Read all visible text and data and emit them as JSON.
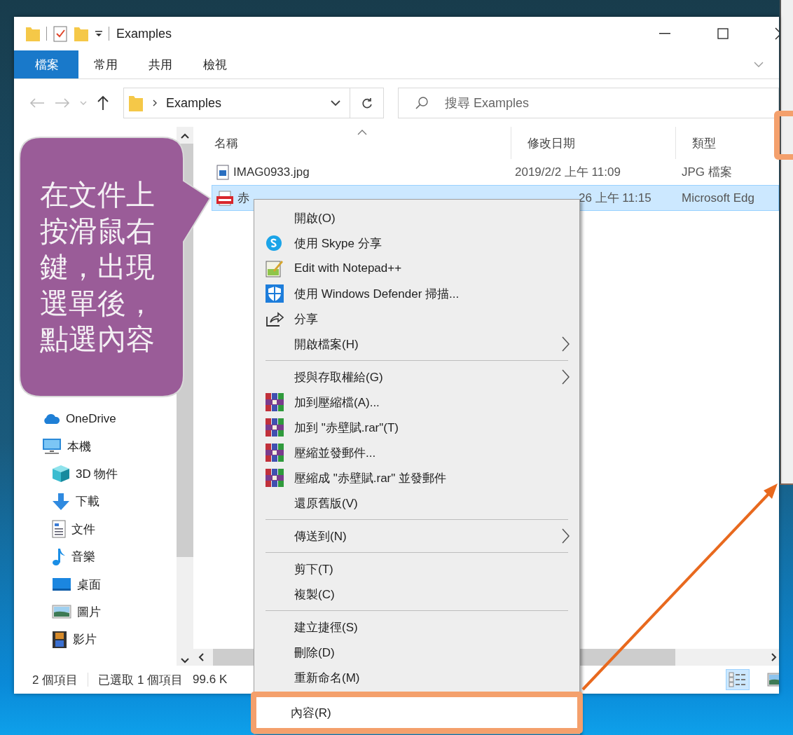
{
  "window": {
    "title": "Examples"
  },
  "ribbon_tabs": [
    {
      "label": "檔案",
      "selected": true
    },
    {
      "label": "常用",
      "selected": false
    },
    {
      "label": "共用",
      "selected": false
    },
    {
      "label": "檢視",
      "selected": false
    }
  ],
  "address": {
    "path": "Examples"
  },
  "search": {
    "placeholder": "搜尋 Examples"
  },
  "columns": [
    "名稱",
    "修改日期",
    "類型"
  ],
  "files": [
    {
      "name": "IMAG0933.jpg",
      "date": "2019/2/2 上午 11:09",
      "type": "JPG 檔案",
      "kind": "image",
      "selected": false
    },
    {
      "name": "赤",
      "date": "26 上午 11:15",
      "type": "Microsoft Edg",
      "kind": "pdf",
      "selected": true
    }
  ],
  "sidebar": [
    {
      "label": "OneDrive",
      "kind": "cloud"
    },
    {
      "label": "本機",
      "kind": "computer",
      "children": [
        {
          "label": "3D 物件",
          "kind": "cube"
        },
        {
          "label": "下載",
          "kind": "download"
        },
        {
          "label": "文件",
          "kind": "document"
        },
        {
          "label": "音樂",
          "kind": "music"
        },
        {
          "label": "桌面",
          "kind": "desktop"
        },
        {
          "label": "圖片",
          "kind": "pictures"
        },
        {
          "label": "影片",
          "kind": "film"
        }
      ]
    }
  ],
  "status_bar": [
    "2 個項目",
    "已選取 1 個項目",
    "99.6 K"
  ],
  "views": [
    {
      "kind": "details",
      "selected": true
    },
    {
      "kind": "large",
      "selected": false
    }
  ],
  "context_menu": [
    [
      {
        "label": "開啟(O)",
        "kind": "plain",
        "submenu": false,
        "annotated": false
      },
      {
        "label": "使用 Skype 分享",
        "kind": "skype",
        "submenu": false,
        "annotated": false
      },
      {
        "label": "Edit with Notepad++",
        "kind": "notepad",
        "submenu": false,
        "annotated": false
      },
      {
        "label": "使用 Windows Defender 掃描...",
        "kind": "shield",
        "submenu": false,
        "annotated": false
      },
      {
        "label": "分享",
        "kind": "share",
        "submenu": false,
        "annotated": false
      },
      {
        "label": "開啟檔案(H)",
        "kind": "plain",
        "submenu": true,
        "annotated": false
      }
    ],
    [
      {
        "label": "授與存取權給(G)",
        "kind": "plain",
        "submenu": true,
        "annotated": false
      },
      {
        "label": "加到壓縮檔(A)...",
        "kind": "rar",
        "submenu": false,
        "annotated": false
      },
      {
        "label": "加到 \"赤壁賦.rar\"(T)",
        "kind": "rar",
        "submenu": false,
        "annotated": false
      },
      {
        "label": "壓縮並發郵件...",
        "kind": "rar",
        "submenu": false,
        "annotated": false
      },
      {
        "label": "壓縮成 \"赤壁賦.rar\" 並發郵件",
        "kind": "rar",
        "submenu": false,
        "annotated": false
      },
      {
        "label": "還原舊版(V)",
        "kind": "plain",
        "submenu": false,
        "annotated": false
      }
    ],
    [
      {
        "label": "傳送到(N)",
        "kind": "plain",
        "submenu": true,
        "annotated": false
      }
    ],
    [
      {
        "label": "剪下(T)",
        "kind": "plain",
        "submenu": false,
        "annotated": false
      },
      {
        "label": "複製(C)",
        "kind": "plain",
        "submenu": false,
        "annotated": false
      }
    ],
    [
      {
        "label": "建立捷徑(S)",
        "kind": "plain",
        "submenu": false,
        "annotated": false
      },
      {
        "label": "刪除(D)",
        "kind": "plain",
        "submenu": false,
        "annotated": false
      },
      {
        "label": "重新命名(M)",
        "kind": "plain",
        "submenu": false,
        "annotated": false
      }
    ],
    [
      {
        "label": "內容(R)",
        "kind": "plain",
        "submenu": false,
        "annotated": true
      }
    ]
  ],
  "callout": {
    "text": "在文件上按滑鼠右鍵，出現選單後，點選內容"
  }
}
